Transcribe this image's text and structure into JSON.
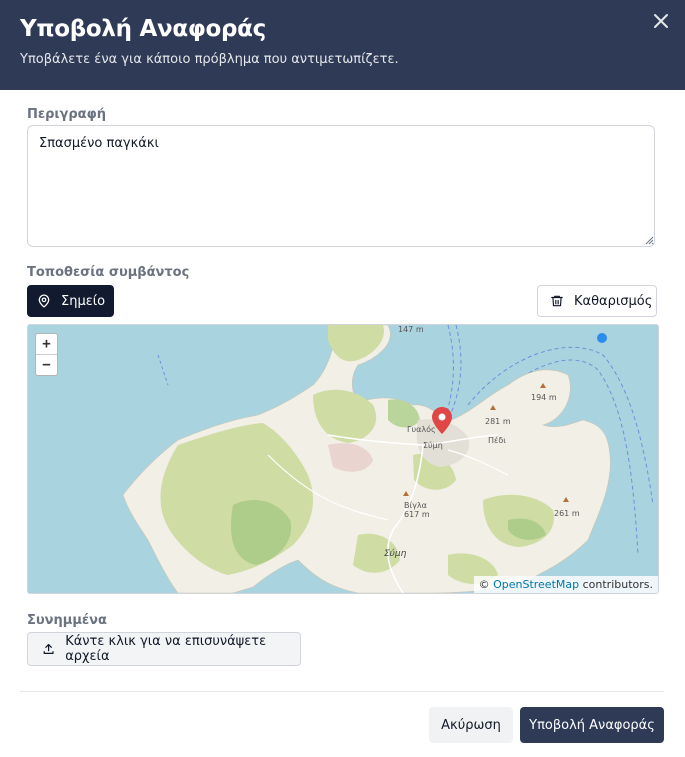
{
  "dialog": {
    "title": "Υποβολή Αναφοράς",
    "subtitle": "Υποβάλετε ένα για κάποιο πρόβλημα που αντιμετωπίζετε.",
    "close_icon": "close-icon"
  },
  "description": {
    "label": "Περιγραφή",
    "value": "Σπασμένο παγκάκι"
  },
  "location": {
    "label": "Τοποθεσία συμβάντος",
    "point_button": "Σημείο",
    "point_icon": "map-pin-icon",
    "clear_button": "Καθαρισμός",
    "clear_icon": "trash-icon"
  },
  "map": {
    "zoom_in": "+",
    "zoom_out": "−",
    "attribution_prefix": "© ",
    "attribution_link": "OpenStreetMap",
    "attribution_suffix": " contributors.",
    "place_labels": {
      "gialos": "Γυαλός",
      "symi_town": "Σύμη",
      "pedi": "Πέδι",
      "symi_island": "Σύμη",
      "vigla": "Βίγλα",
      "vigla_elev": "617 m",
      "peak_281": "281 m",
      "peak_194": "194 m",
      "peak_147": "147 m",
      "peak_261": "261 m"
    },
    "colors": {
      "sea": "#a9d3df",
      "land": "#f1efe6",
      "forest": "#cfdca4",
      "marker": "#e04646"
    }
  },
  "attachments": {
    "label": "Συνημμένα",
    "button": "Κάντε κλικ για να επισυνάψετε αρχεία",
    "icon": "upload-icon"
  },
  "footer": {
    "cancel": "Ακύρωση",
    "submit": "Υποβολή Αναφοράς"
  },
  "colors": {
    "header_bg": "#2e3a56",
    "primary_button": "#2e3a56",
    "point_button": "#111a2e"
  }
}
